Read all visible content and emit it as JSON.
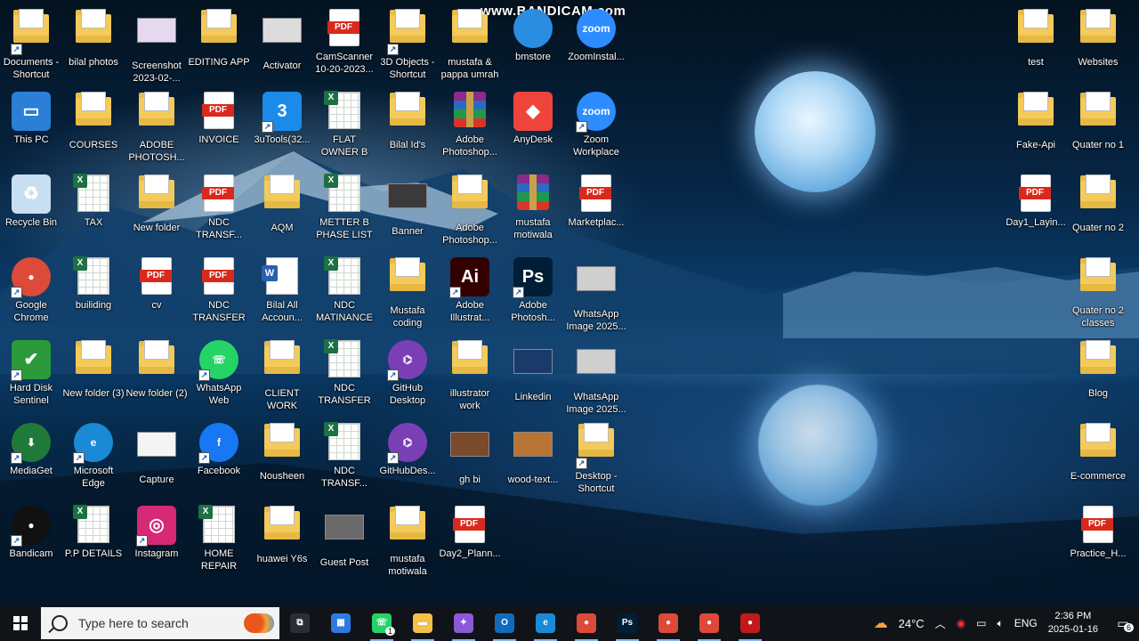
{
  "watermark": "www.BANDICAM.com",
  "desktop_icons": [
    {
      "label": "Documents - Shortcut",
      "type": "folder",
      "shortcut": true
    },
    {
      "label": "bilal photos",
      "type": "folder"
    },
    {
      "label": "Screenshot 2023-02-...",
      "type": "thumb",
      "color": "#e6d8ee"
    },
    {
      "label": "EDITING APP",
      "type": "folder"
    },
    {
      "label": "Activator",
      "type": "thumb",
      "color": "#dcdcdc"
    },
    {
      "label": "CamScanner 10-20-2023...",
      "type": "pdf"
    },
    {
      "label": "3D Objects - Shortcut",
      "type": "folder",
      "shortcut": true
    },
    {
      "label": "mustafa & pappa umrah",
      "type": "folder"
    },
    {
      "label": "bmstore",
      "type": "round",
      "color": "#2a8de0",
      "text": ""
    },
    {
      "label": "ZoomInstal...",
      "type": "round",
      "color": "#2d8cff",
      "text": "zoom"
    },
    {
      "label": "This PC",
      "type": "square",
      "color": "#2b7fd6",
      "text": "▭"
    },
    {
      "label": "COURSES",
      "type": "folder"
    },
    {
      "label": "ADOBE PHOTOSH...",
      "type": "folder"
    },
    {
      "label": "INVOICE",
      "type": "pdf"
    },
    {
      "label": "3uTools(32...",
      "type": "square",
      "color": "#1c8ae8",
      "text": "3",
      "shortcut": true
    },
    {
      "label": "FLAT OWNER B PHASE",
      "type": "xls"
    },
    {
      "label": "Bilal Id's",
      "type": "folder"
    },
    {
      "label": "Adobe Photoshop...",
      "type": "rar"
    },
    {
      "label": "AnyDesk",
      "type": "square",
      "color": "#ef443b",
      "text": "◆"
    },
    {
      "label": "Zoom Workplace",
      "type": "round",
      "color": "#2d8cff",
      "text": "zoom",
      "shortcut": true
    },
    {
      "label": "Recycle Bin",
      "type": "square",
      "color": "#c7dff0",
      "text": "♻"
    },
    {
      "label": "TAX",
      "type": "xls"
    },
    {
      "label": "New folder",
      "type": "folder"
    },
    {
      "label": "NDC TRANSF...",
      "type": "pdf"
    },
    {
      "label": "AQM",
      "type": "folder"
    },
    {
      "label": "METTER B PHASE LIST",
      "type": "xls"
    },
    {
      "label": "Banner",
      "type": "thumb",
      "color": "#3a3a3a"
    },
    {
      "label": "Adobe Photoshop...",
      "type": "folder"
    },
    {
      "label": "mustafa motiwala",
      "type": "rar"
    },
    {
      "label": "Marketplac...",
      "type": "pdf"
    },
    {
      "label": "Google Chrome",
      "type": "round",
      "color": "#dd4a3a",
      "text": "●",
      "shortcut": true
    },
    {
      "label": "builiding",
      "type": "xls"
    },
    {
      "label": "cv",
      "type": "pdf"
    },
    {
      "label": "NDC TRANSFER",
      "type": "pdf"
    },
    {
      "label": "Bilal All Accoun...",
      "type": "doc"
    },
    {
      "label": "NDC MATINANCE",
      "type": "xls"
    },
    {
      "label": "Mustafa coding",
      "type": "folder"
    },
    {
      "label": "Adobe Illustrat...",
      "type": "square",
      "color": "#330000",
      "text": "Ai",
      "shortcut": true
    },
    {
      "label": "Adobe Photosh...",
      "type": "square",
      "color": "#001e36",
      "text": "Ps",
      "shortcut": true
    },
    {
      "label": "WhatsApp Image 2025...",
      "type": "thumb",
      "color": "#cfcfcf"
    },
    {
      "label": "Hard Disk Sentinel",
      "type": "square",
      "color": "#2a9a3a",
      "text": "✔",
      "shortcut": true
    },
    {
      "label": "New folder (3)",
      "type": "folder"
    },
    {
      "label": "New folder (2)",
      "type": "folder"
    },
    {
      "label": "WhatsApp Web",
      "type": "round",
      "color": "#25d366",
      "text": "☏",
      "shortcut": true
    },
    {
      "label": "CLIENT WORK",
      "type": "folder"
    },
    {
      "label": "NDC TRANSFER",
      "type": "xls"
    },
    {
      "label": "GitHub Desktop",
      "type": "round",
      "color": "#7b3fb5",
      "text": "⌬",
      "shortcut": true
    },
    {
      "label": "illustrator work",
      "type": "folder"
    },
    {
      "label": "Linkedin",
      "type": "thumb",
      "color": "#1a3a6a"
    },
    {
      "label": "WhatsApp Image 2025...",
      "type": "thumb",
      "color": "#cfcfcf"
    },
    {
      "label": "MediaGet",
      "type": "round",
      "color": "#1f7a3a",
      "text": "⬇",
      "shortcut": true
    },
    {
      "label": "Microsoft Edge",
      "type": "round",
      "color": "#1b8ad6",
      "text": "e",
      "shortcut": true
    },
    {
      "label": "Capture",
      "type": "thumb",
      "color": "#f4f4f4"
    },
    {
      "label": "Facebook",
      "type": "round",
      "color": "#1877f2",
      "text": "f",
      "shortcut": true
    },
    {
      "label": "Nousheen",
      "type": "folder"
    },
    {
      "label": "NDC TRANSF...",
      "type": "xls"
    },
    {
      "label": "GitHubDes...",
      "type": "round",
      "color": "#7b3fb5",
      "text": "⌬",
      "shortcut": true
    },
    {
      "label": "gh bi",
      "type": "thumb",
      "color": "#7a4a2a"
    },
    {
      "label": "wood-text...",
      "type": "thumb",
      "color": "#b87434"
    },
    {
      "label": "Desktop - Shortcut",
      "type": "folder",
      "shortcut": true
    },
    {
      "label": "Bandicam",
      "type": "round",
      "color": "#111111",
      "text": "●",
      "shortcut": true
    },
    {
      "label": "P.P DETAILS",
      "type": "xls"
    },
    {
      "label": "Instagram",
      "type": "square",
      "color": "#d62976",
      "text": "◎",
      "shortcut": true
    },
    {
      "label": "HOME REPAIR",
      "type": "xls"
    },
    {
      "label": "huawei Y6s",
      "type": "folder"
    },
    {
      "label": "Guest Post",
      "type": "thumb",
      "color": "#6a6a6a"
    },
    {
      "label": "mustafa motiwala",
      "type": "folder"
    },
    {
      "label": "Day2_Plann...",
      "type": "pdf"
    }
  ],
  "right_icons": [
    {
      "label": "test",
      "type": "folder"
    },
    {
      "label": "Websites",
      "type": "folder"
    },
    {
      "label": "Fake-Api",
      "type": "folder"
    },
    {
      "label": "Quater no 1",
      "type": "folder"
    },
    {
      "label": "Day1_Layin...",
      "type": "pdf"
    },
    {
      "label": "Quater no 2",
      "type": "folder"
    },
    {
      "label": "Quater no 2 classes",
      "type": "folder"
    },
    {
      "label": "Blog",
      "type": "folder"
    },
    {
      "label": "E-commerce",
      "type": "folder"
    },
    {
      "label": "Practice_H...",
      "type": "pdf"
    }
  ],
  "taskbar": {
    "search_placeholder": "Type here to search",
    "apps": [
      {
        "name": "task-view",
        "color": "#2a2f36",
        "text": "⧉"
      },
      {
        "name": "microsoft-store",
        "color": "#2d7be0",
        "text": "▦"
      },
      {
        "name": "whatsapp",
        "color": "#25d366",
        "text": "☏",
        "badge": "1"
      },
      {
        "name": "file-explorer",
        "color": "#f4c04a",
        "text": "▬"
      },
      {
        "name": "copilot",
        "color": "#8a5ad6",
        "text": "✦"
      },
      {
        "name": "outlook",
        "color": "#0f6cbd",
        "text": "O"
      },
      {
        "name": "edge",
        "color": "#1b8ad6",
        "text": "e"
      },
      {
        "name": "chrome",
        "color": "#dd4a3a",
        "text": "●"
      },
      {
        "name": "photoshop",
        "color": "#001e36",
        "text": "Ps"
      },
      {
        "name": "chrome-profile-1",
        "color": "#dd4a3a",
        "text": "●"
      },
      {
        "name": "chrome-profile-2",
        "color": "#dd4a3a",
        "text": "●"
      },
      {
        "name": "bandicam",
        "color": "#c21a1a",
        "text": "●"
      }
    ],
    "weather": "24°C",
    "language": "ENG",
    "time": "2:36 PM",
    "date": "2025-01-16",
    "notification_count": "6"
  }
}
